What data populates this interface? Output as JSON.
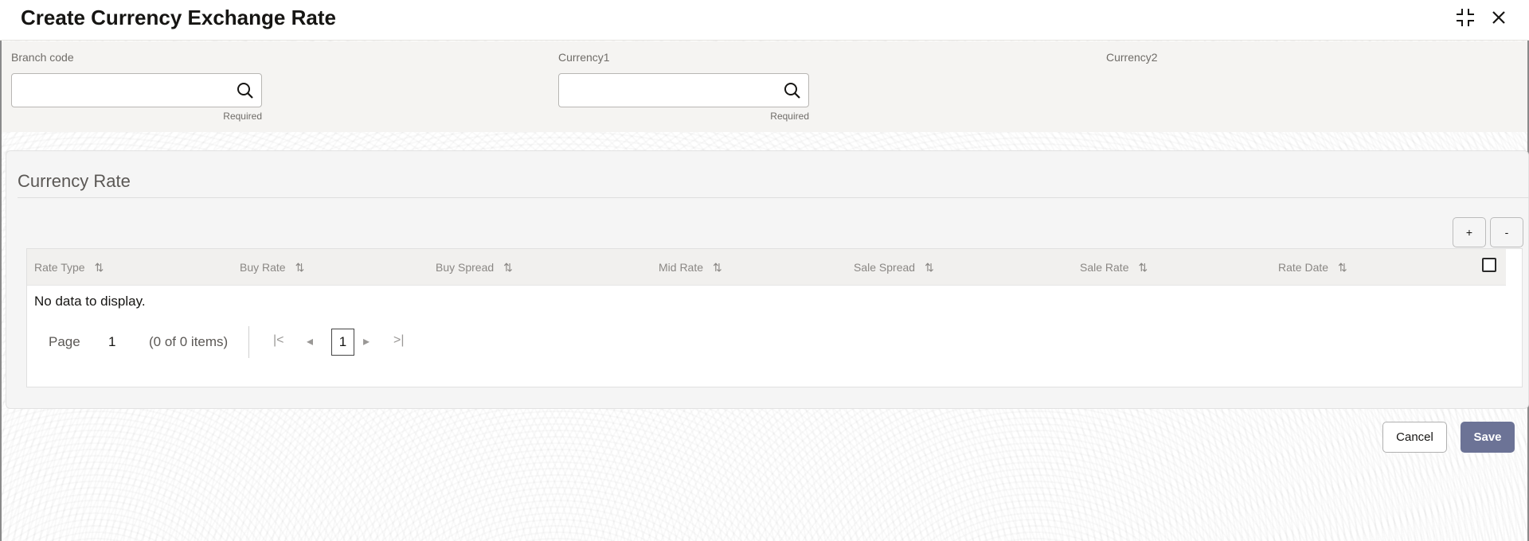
{
  "header": {
    "title": "Create Currency Exchange Rate",
    "minimize_icon": "collapse-icon",
    "close_icon": "close-icon"
  },
  "filters": {
    "branch_code": {
      "label": "Branch code",
      "value": "",
      "placeholder": "",
      "help": "Required",
      "icon": "search-icon"
    },
    "currency1": {
      "label": "Currency1",
      "value": "",
      "placeholder": "",
      "help": "Required",
      "icon": "search-icon"
    },
    "currency2": {
      "label": "Currency2"
    }
  },
  "section": {
    "title": "Currency Rate",
    "add_label": "+",
    "remove_label": "-",
    "table": {
      "columns": [
        {
          "label": "Rate Type",
          "sort_icon": "⇅"
        },
        {
          "label": "Buy Rate",
          "sort_icon": "⇅"
        },
        {
          "label": "Buy Spread",
          "sort_icon": "⇅"
        },
        {
          "label": "Mid Rate",
          "sort_icon": "⇅"
        },
        {
          "label": "Sale Spread",
          "sort_icon": "⇅"
        },
        {
          "label": "Sale Rate",
          "sort_icon": "⇅"
        },
        {
          "label": "Rate Date",
          "sort_icon": "⇅"
        }
      ],
      "rows": [],
      "empty_message": "No data to display."
    },
    "pagination": {
      "page_label": "Page",
      "page_value": "1",
      "items_summary": "(0 of 0 items)",
      "current_page": "1",
      "first_icon": "|<",
      "prev_icon": "◂",
      "next_icon": "▸",
      "last_icon": ">|"
    }
  },
  "footer": {
    "cancel_label": "Cancel",
    "save_label": "Save"
  },
  "colors": {
    "primary_button": "#6c7396",
    "filter_band": "#f5f4f2",
    "table_header": "#f1f0ee"
  }
}
